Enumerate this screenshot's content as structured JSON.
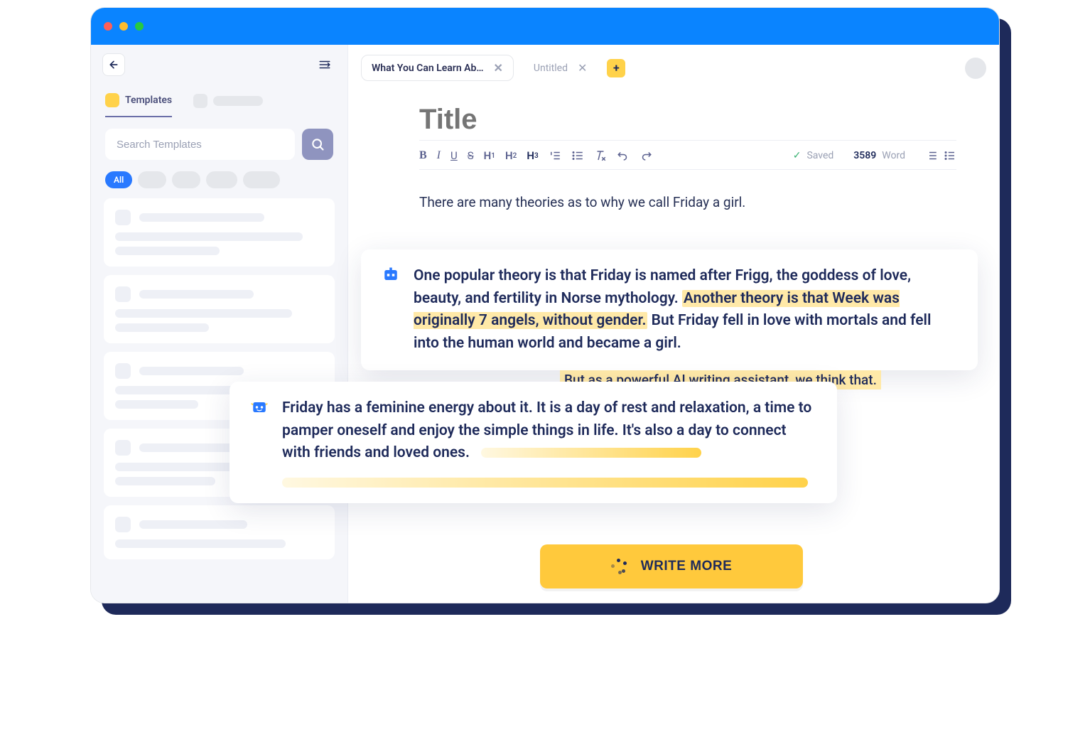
{
  "sidebar": {
    "tabs": {
      "templates_label": "Templates"
    },
    "search": {
      "placeholder": "Search Templates"
    },
    "filters": {
      "all_label": "All"
    }
  },
  "docTabs": {
    "tab1": {
      "label": "What You Can Learn Ab…"
    },
    "tab2": {
      "label": "Untitled"
    }
  },
  "editor": {
    "title_placeholder": "Title",
    "status": {
      "saved_label": "Saved",
      "word_count": "3589",
      "word_label": "Word"
    },
    "body_line1": "There are many theories as to why we call Friday a girl.",
    "card1": {
      "part1": "One popular theory is that Friday is named after Frigg, the goddess of love, beauty, and fertility in Norse mythology. ",
      "highlight": "Another theory is that Week was originally 7 angels, without gender.",
      "part2": " But Friday fell in love with mortals and fell into the human world and became a girl."
    },
    "bridge_text": "But as a powerful AI writing assistant, we think that.",
    "card2": {
      "text": "Friday has a feminine energy about it. It is a day of rest and relaxation, a time to pamper oneself and enjoy the simple things in life. It's also a day to connect with friends and loved ones."
    },
    "write_more_label": "WRITE MORE"
  },
  "toolbar": {
    "bold": "B",
    "italic": "I",
    "underline": "U",
    "strike": "S",
    "h1": "H",
    "h1sub": "1",
    "h2": "H",
    "h2sub": "2",
    "h3": "H",
    "h3sub": "3"
  }
}
